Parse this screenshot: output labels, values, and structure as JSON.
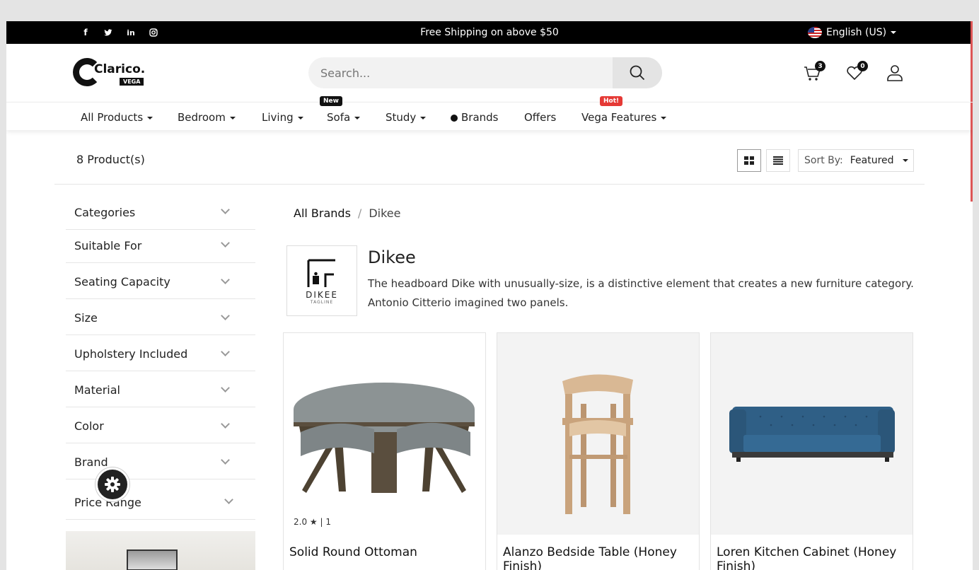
{
  "topbar": {
    "promo": "Free Shipping on above $50",
    "language": "English (US)",
    "social": [
      "facebook-icon",
      "twitter-icon",
      "linkedin-icon",
      "instagram-icon"
    ]
  },
  "header": {
    "logo_text": "Clarico.",
    "logo_badge": "VEGA",
    "search_placeholder": "Search...",
    "cart_count": "3",
    "wishlist_count": "0"
  },
  "nav": {
    "items": [
      "All Products",
      "Bedroom",
      "Living",
      "Sofa",
      "Study",
      "Brands",
      "Offers",
      "Vega Features"
    ],
    "tag_new": "New",
    "tag_hot": "Hot!"
  },
  "toolbar": {
    "count": "8 Product(s)",
    "sort_label": "Sort By:",
    "sort_value": "Featured"
  },
  "filters": [
    "Categories",
    "Suitable For",
    "Seating Capacity",
    "Size",
    "Upholstery Included",
    "Material",
    "Color",
    "Brand",
    "Price Range"
  ],
  "breadcrumb": {
    "parent": "All Brands",
    "sep": "/",
    "current": "Dikee"
  },
  "brand": {
    "name": "Dikee",
    "logo_text": "DIKEE",
    "logo_tagline": "TAGLINE",
    "description": "The headboard Dike with unusually-size, is a distinctive element that creates a new furniture category. Antonio Citterio imagined two panels."
  },
  "products": [
    {
      "name": "Solid Round Ottoman",
      "rating": "2.0",
      "reviews": "1"
    },
    {
      "name": "Alanzo Bedside Table (Honey Finish)"
    },
    {
      "name": "Loren Kitchen Cabinet (Honey Finish)"
    }
  ],
  "colors": {
    "accent_red": "#e53935",
    "dark": "#111111",
    "sofa_blue": "#2f5f86"
  }
}
